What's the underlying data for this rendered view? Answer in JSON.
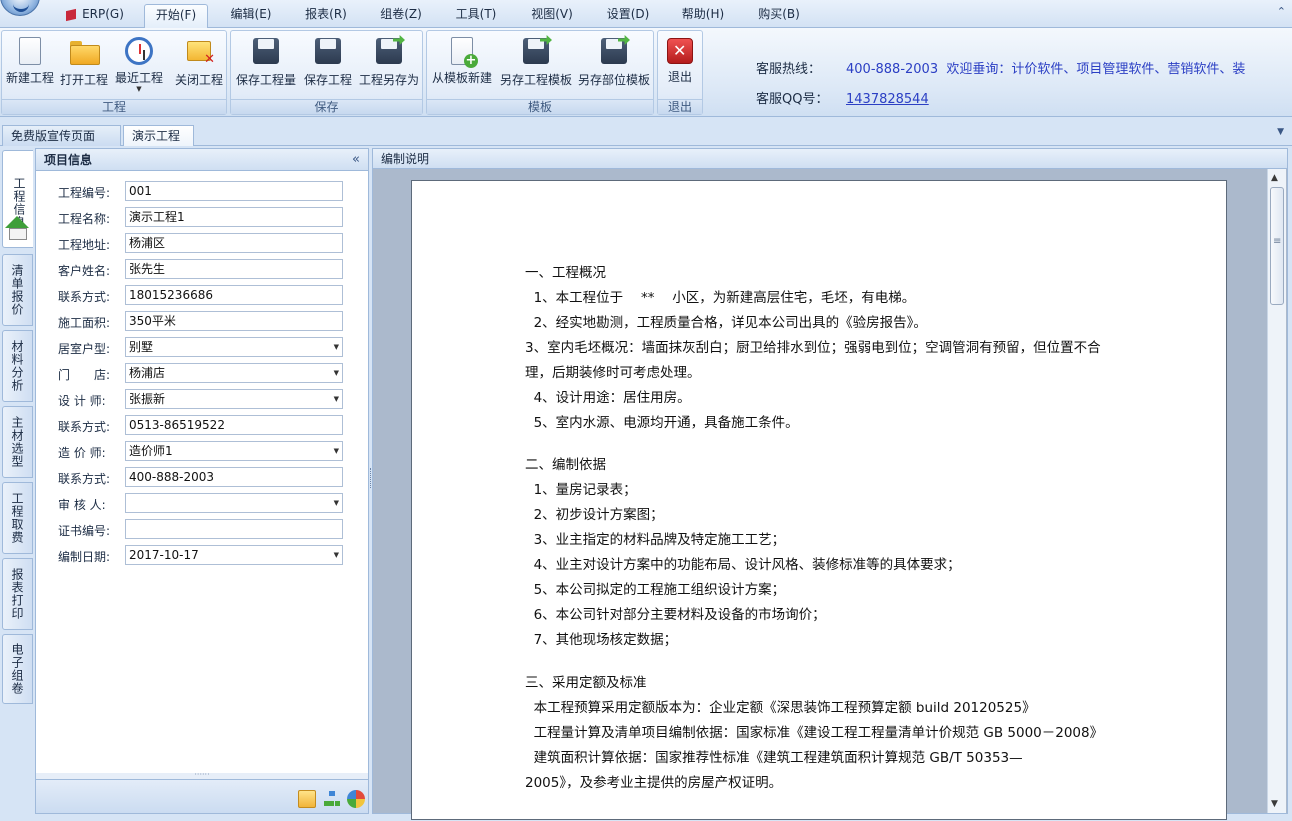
{
  "menu": {
    "tabs": [
      {
        "label": "ERP(G)"
      },
      {
        "label": "开始(F)"
      },
      {
        "label": "编辑(E)"
      },
      {
        "label": "报表(R)"
      },
      {
        "label": "组卷(Z)"
      },
      {
        "label": "工具(T)"
      },
      {
        "label": "视图(V)"
      },
      {
        "label": "设置(D)"
      },
      {
        "label": "帮助(H)"
      },
      {
        "label": "购买(B)"
      }
    ],
    "collapse_glyph": "⌃"
  },
  "ribbon": {
    "groups": [
      {
        "label": "工程",
        "buttons": [
          {
            "label": "新建工程",
            "icon": "new-document-icon"
          },
          {
            "label": "打开工程",
            "icon": "open-folder-icon"
          },
          {
            "label": "最近工程",
            "icon": "recent-clock-icon"
          },
          {
            "label": "关闭工程",
            "icon": "close-project-icon"
          }
        ]
      },
      {
        "label": "保存",
        "buttons": [
          {
            "label": "保存工程量",
            "icon": "save-disk-icon"
          },
          {
            "label": "保存工程",
            "icon": "save-disk-icon"
          },
          {
            "label": "工程另存为",
            "icon": "save-as-icon"
          }
        ]
      },
      {
        "label": "模板",
        "buttons": [
          {
            "label": "从模板新建",
            "icon": "template-new-icon"
          },
          {
            "label": "另存工程模板",
            "icon": "save-as-icon"
          },
          {
            "label": "另存部位模板",
            "icon": "save-as-icon"
          }
        ]
      },
      {
        "label": "退出",
        "buttons": [
          {
            "label": "退出",
            "icon": "exit-icon"
          }
        ]
      }
    ],
    "hotline_label": "客服热线：",
    "hotline_number": "400-888-2003",
    "hotline_message": "欢迎垂询：计价软件、项目管理软件、营销软件、装",
    "qq_label": "客服QQ号：",
    "qq_number": "1437828544"
  },
  "doc_tabs": [
    {
      "label": "免费版宣传页面",
      "active": false
    },
    {
      "label": "演示工程1",
      "active": true
    }
  ],
  "side_tabs": [
    {
      "label": "工程信息",
      "active": true
    },
    {
      "label": "清单报价",
      "active": false
    },
    {
      "label": "材料分析",
      "active": false
    },
    {
      "label": "主材选型",
      "active": false
    },
    {
      "label": "工程取费",
      "active": false
    },
    {
      "label": "报表打印",
      "active": false
    },
    {
      "label": "电子组卷",
      "active": false
    }
  ],
  "project_panel": {
    "title": "项目信息",
    "collapse_glyph": "«",
    "fields": [
      {
        "label": "工程编号:",
        "value": "001",
        "dropdown": false
      },
      {
        "label": "工程名称:",
        "value": "演示工程1",
        "dropdown": false
      },
      {
        "label": "工程地址:",
        "value": "杨浦区",
        "dropdown": false
      },
      {
        "label": "客户姓名:",
        "value": "张先生",
        "dropdown": false
      },
      {
        "label": "联系方式:",
        "value": "18015236686",
        "dropdown": false
      },
      {
        "label": "施工面积:",
        "value": "350平米",
        "dropdown": false
      },
      {
        "label": "居室户型:",
        "value": "别墅",
        "dropdown": true
      },
      {
        "label": "门　　店:",
        "value": "杨浦店",
        "dropdown": true
      },
      {
        "label": "设 计 师:",
        "value": "张振新",
        "dropdown": true
      },
      {
        "label": "联系方式:",
        "value": "0513-86519522",
        "dropdown": false
      },
      {
        "label": "造 价 师:",
        "value": "造价师1",
        "dropdown": true
      },
      {
        "label": "联系方式:",
        "value": "400-888-2003",
        "dropdown": false
      },
      {
        "label": "审 核 人:",
        "value": "",
        "dropdown": true
      },
      {
        "label": "证书编号:",
        "value": "",
        "dropdown": false
      },
      {
        "label": "编制日期:",
        "value": "2017-10-17",
        "dropdown": true
      }
    ]
  },
  "editor": {
    "title": "编制说明",
    "lines": [
      "一、工程概况",
      "  1、本工程位于　 **　 小区，为新建高层住宅，毛坯，有电梯。",
      "  2、经实地勘测，工程质量合格，详见本公司出具的《验房报告》。",
      "3、室内毛坯概况：墙面抹灰刮白；厨卫给排水到位；强弱电到位；空调管洞有预留，但位置不合",
      "理，后期装修时可考虑处理。",
      "  4、设计用途：居住用房。",
      "  5、室内水源、电源均开通，具备施工条件。",
      "二、编制依据",
      "  1、量房记录表；",
      "  2、初步设计方案图；",
      "  3、业主指定的材料品牌及特定施工工艺；",
      "  4、业主对设计方案中的功能布局、设计风格、装修标准等的具体要求；",
      "  5、本公司拟定的工程施工组织设计方案；",
      "  6、本公司针对部分主要材料及设备的市场询价；",
      "  7、其他现场核定数据；",
      "三、采用定额及标准",
      "  本工程预算采用定额版本为：企业定额《深思装饰工程预算定额 build 20120525》",
      "  工程量计算及清单项目编制依据：国家标准《建设工程工程量清单计价规范 GB 5000－2008》",
      "  建筑面积计算依据：国家推荐性标准《建筑工程建筑面积计算规范 GB/T 50353—",
      "2005》，及参考业主提供的房屋产权证明。"
    ]
  },
  "colors": {
    "accent_blue": "#2b3fc4",
    "ribbon_bg": "#dce8f6",
    "exit_red": "#d42121"
  }
}
